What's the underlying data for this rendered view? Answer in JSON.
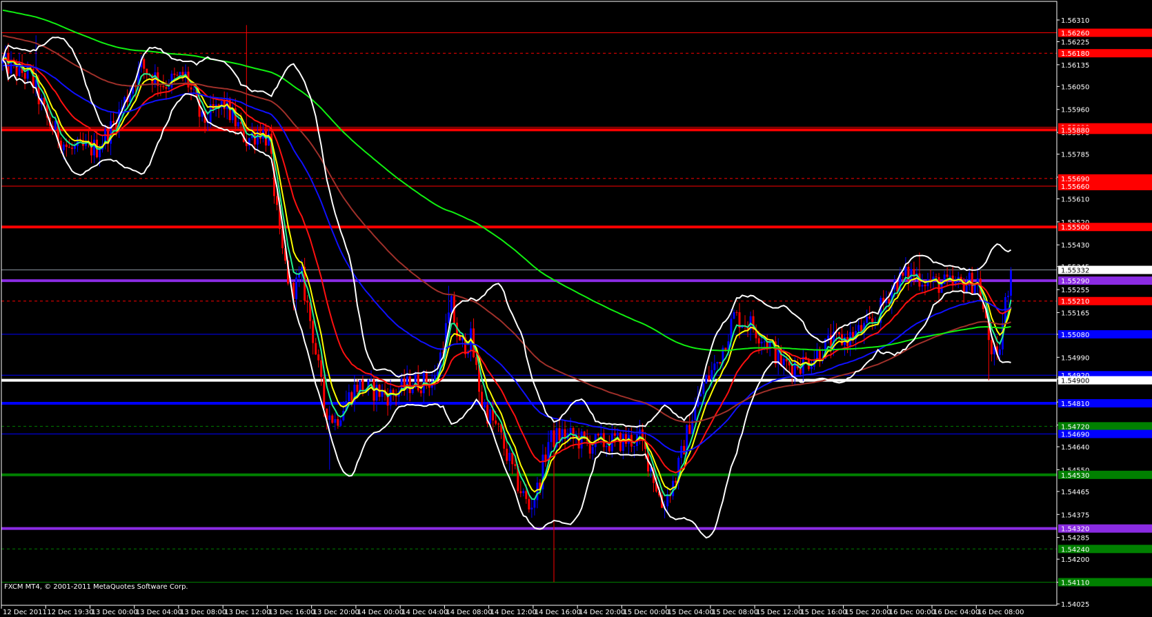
{
  "copyright": "FXCM MT4, © 2001-2011 MetaQuotes Software Corp.",
  "colors": {
    "background": "#000000",
    "bull": "#0000ff",
    "bear": "#ff0000",
    "axis": "#ffffff"
  },
  "chart_data": {
    "type": "candlestick",
    "symbol_timeframe": "M15",
    "ylim": [
      1.54025,
      1.5631
    ],
    "y_ticks": [
      "1.56310",
      "1.56225",
      "1.56135",
      "1.56050",
      "1.55960",
      "1.55870",
      "1.55785",
      "1.55695",
      "1.55610",
      "1.55520",
      "1.55430",
      "1.55345",
      "1.55255",
      "1.55165",
      "1.55080",
      "1.54990",
      "1.54905",
      "1.54815",
      "1.54725",
      "1.54640",
      "1.54550",
      "1.54465",
      "1.54375",
      "1.54285",
      "1.54200",
      "1.54110",
      "1.54025"
    ],
    "x_ticks": [
      {
        "bar": 0,
        "label": "12 Dec 2011"
      },
      {
        "bar": 16,
        "label": "12 Dec 19:30"
      },
      {
        "bar": 32,
        "label": "13 Dec 00:00"
      },
      {
        "bar": 48,
        "label": "13 Dec 04:00"
      },
      {
        "bar": 64,
        "label": "13 Dec 08:00"
      },
      {
        "bar": 80,
        "label": "13 Dec 12:00"
      },
      {
        "bar": 96,
        "label": "13 Dec 16:00"
      },
      {
        "bar": 112,
        "label": "13 Dec 20:00"
      },
      {
        "bar": 128,
        "label": "14 Dec 00:00"
      },
      {
        "bar": 144,
        "label": "14 Dec 04:00"
      },
      {
        "bar": 160,
        "label": "14 Dec 08:00"
      },
      {
        "bar": 176,
        "label": "14 Dec 12:00"
      },
      {
        "bar": 192,
        "label": "14 Dec 16:00"
      },
      {
        "bar": 208,
        "label": "14 Dec 20:00"
      },
      {
        "bar": 224,
        "label": "15 Dec 00:00"
      },
      {
        "bar": 240,
        "label": "15 Dec 04:00"
      },
      {
        "bar": 256,
        "label": "15 Dec 08:00"
      },
      {
        "bar": 272,
        "label": "15 Dec 12:00"
      },
      {
        "bar": 288,
        "label": "15 Dec 16:00"
      },
      {
        "bar": 304,
        "label": "15 Dec 20:00"
      },
      {
        "bar": 320,
        "label": "16 Dec 00:00"
      },
      {
        "bar": 336,
        "label": "16 Dec 04:00"
      },
      {
        "bar": 352,
        "label": "16 Dec 08:00"
      }
    ],
    "bar_count": 365,
    "price_path": [
      [
        0,
        1.5614
      ],
      [
        10,
        1.5609
      ],
      [
        16,
        1.5592
      ],
      [
        24,
        1.558
      ],
      [
        34,
        1.5581
      ],
      [
        40,
        1.559
      ],
      [
        50,
        1.5613
      ],
      [
        58,
        1.5606
      ],
      [
        66,
        1.5609
      ],
      [
        72,
        1.5591
      ],
      [
        80,
        1.5598
      ],
      [
        88,
        1.5584
      ],
      [
        93,
        1.5588
      ],
      [
        96,
        1.5584
      ],
      [
        100,
        1.5545
      ],
      [
        104,
        1.5525
      ],
      [
        108,
        1.553
      ],
      [
        112,
        1.5508
      ],
      [
        116,
        1.548
      ],
      [
        120,
        1.5474
      ],
      [
        124,
        1.5482
      ],
      [
        128,
        1.5488
      ],
      [
        134,
        1.5486
      ],
      [
        140,
        1.5484
      ],
      [
        148,
        1.5489
      ],
      [
        156,
        1.549
      ],
      [
        159,
        1.5505
      ],
      [
        162,
        1.5519
      ],
      [
        165,
        1.5503
      ],
      [
        169,
        1.5506
      ],
      [
        173,
        1.5481
      ],
      [
        179,
        1.547
      ],
      [
        185,
        1.5452
      ],
      [
        190,
        1.544
      ],
      [
        193,
        1.5447
      ],
      [
        197,
        1.5466
      ],
      [
        202,
        1.5469
      ],
      [
        212,
        1.5465
      ],
      [
        222,
        1.5466
      ],
      [
        230,
        1.5467
      ],
      [
        234,
        1.5456
      ],
      [
        238,
        1.5441
      ],
      [
        243,
        1.5452
      ],
      [
        248,
        1.5473
      ],
      [
        253,
        1.5488
      ],
      [
        258,
        1.5497
      ],
      [
        264,
        1.5515
      ],
      [
        270,
        1.5512
      ],
      [
        276,
        1.5505
      ],
      [
        282,
        1.5496
      ],
      [
        290,
        1.5497
      ],
      [
        298,
        1.5504
      ],
      [
        306,
        1.5507
      ],
      [
        314,
        1.5512
      ],
      [
        322,
        1.5528
      ],
      [
        328,
        1.5532
      ],
      [
        336,
        1.5528
      ],
      [
        344,
        1.5527
      ],
      [
        352,
        1.5529
      ],
      [
        356,
        1.5506
      ],
      [
        359,
        1.5496
      ],
      [
        362,
        1.552
      ],
      [
        364,
        1.5533
      ]
    ],
    "extreme_wicks": [
      [
        88,
        1.5629
      ],
      [
        12,
        1.5625
      ],
      [
        118,
        1.5455
      ],
      [
        161,
        1.5527
      ],
      [
        199,
        1.5411
      ],
      [
        239,
        1.5436
      ],
      [
        331,
        1.554
      ],
      [
        356,
        1.549
      ]
    ],
    "current_price": "1.55332",
    "moving_averages": [
      {
        "name": "EMA 5",
        "period": 5,
        "color": "#20f090"
      },
      {
        "name": "EMA 8",
        "period": 8,
        "color": "#ffff00"
      },
      {
        "name": "EMA 21",
        "period": 21,
        "color": "#ff1010"
      },
      {
        "name": "EMA 55",
        "period": 55,
        "color": "#1010ff",
        "seed": 1.5613
      },
      {
        "name": "EMA 100",
        "period": 100,
        "color": "#a0302a",
        "seed": 1.5625
      },
      {
        "name": "EMA 200",
        "period": 200,
        "color": "#10f010",
        "seed": 1.5635
      }
    ],
    "bollinger": {
      "period": 20,
      "deviation": 2,
      "color": "#ffffff"
    },
    "levels": [
      {
        "price": 1.5626,
        "label": "1.56260",
        "color": "#ff0000",
        "style": "solid"
      },
      {
        "price": 1.5618,
        "label": "1.56180",
        "color": "#ff0000",
        "style": "dashed"
      },
      {
        "price": 1.5589,
        "label": "1.55890",
        "color": "#ff0000",
        "style": "solid"
      },
      {
        "price": 1.5588,
        "label": "1.55880",
        "color": "#ff0000",
        "style": "thick"
      },
      {
        "price": 1.5569,
        "label": "1.55690",
        "color": "#ff0000",
        "style": "dashed"
      },
      {
        "price": 1.5566,
        "label": "1.55660",
        "color": "#ff0000",
        "style": "solid"
      },
      {
        "price": 1.555,
        "label": "1.55500",
        "color": "#ff0000",
        "style": "thick"
      },
      {
        "price": 1.55332,
        "label": "1.55332",
        "color": "#8c96a0",
        "style": "solid",
        "label_bg": "#ffffff"
      },
      {
        "price": 1.5529,
        "label": "1.55290",
        "color": "#8a2be2",
        "style": "thick"
      },
      {
        "price": 1.5521,
        "label": "1.55210",
        "color": "#ff0000",
        "style": "dashed"
      },
      {
        "price": 1.5508,
        "label": "1.55080",
        "color": "#0000ff",
        "style": "solid"
      },
      {
        "price": 1.5492,
        "label": "1.54920",
        "color": "#0000ff",
        "style": "solid"
      },
      {
        "price": 1.549,
        "label": "1.54900",
        "color": "#ffffff",
        "style": "thick"
      },
      {
        "price": 1.5481,
        "label": "1.54810",
        "color": "#0000ff",
        "style": "thick"
      },
      {
        "price": 1.5472,
        "label": "1.54720",
        "color": "#008000",
        "style": "dashed"
      },
      {
        "price": 1.5469,
        "label": "1.54690",
        "color": "#0000ff",
        "style": "solid"
      },
      {
        "price": 1.5453,
        "label": "1.54530",
        "color": "#008000",
        "style": "thick"
      },
      {
        "price": 1.5432,
        "label": "1.54320",
        "color": "#8a2be2",
        "style": "thick"
      },
      {
        "price": 1.5424,
        "label": "1.54240",
        "color": "#008000",
        "style": "dashed"
      },
      {
        "price": 1.5411,
        "label": "1.54110",
        "color": "#008000",
        "style": "solid"
      }
    ]
  }
}
